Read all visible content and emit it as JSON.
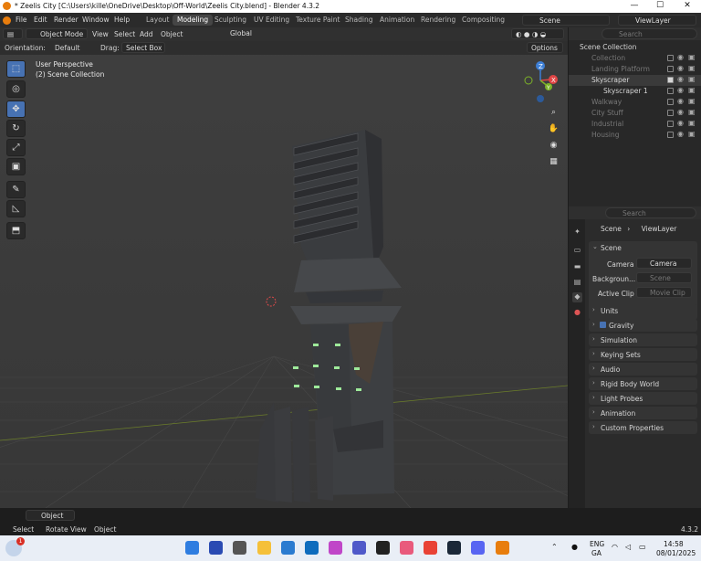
{
  "window": {
    "title": "* Zeelis City [C:\\Users\\kille\\OneDrive\\Desktop\\Off-World\\Zeelis City.blend] - Blender 4.3.2",
    "min": "—",
    "max": "☐",
    "close": "✕"
  },
  "menus": [
    "File",
    "Edit",
    "Render",
    "Window",
    "Help"
  ],
  "workspaces": [
    "Layout",
    "Modeling",
    "Sculpting",
    "UV Editing",
    "Texture Paint",
    "Shading",
    "Animation",
    "Rendering",
    "Compositing"
  ],
  "active_workspace": "Modeling",
  "scene": "Scene",
  "view_layer": "ViewLayer",
  "header": {
    "mode": "Object Mode",
    "view": "View",
    "select": "Select",
    "add": "Add",
    "object": "Object",
    "transform": "Global"
  },
  "toolsettings": {
    "orientation_label": "Orientation:",
    "orientation": "Default",
    "drag_label": "Drag:",
    "drag": "Select Box",
    "options": "Options"
  },
  "viewport": {
    "line1": "User Perspective",
    "line2": "(2) Scene Collection"
  },
  "gizmo": {
    "x": "X",
    "y": "Y",
    "z": "Z"
  },
  "search_placeholder": "Search",
  "outliner": [
    {
      "name": "Scene Collection",
      "level": 0,
      "dim": false,
      "checked": false,
      "icons": false
    },
    {
      "name": "Collection",
      "level": 1,
      "dim": true,
      "checked": false,
      "icons": true
    },
    {
      "name": "Landing Platform",
      "level": 1,
      "dim": true,
      "checked": false,
      "icons": true
    },
    {
      "name": "Skyscraper",
      "level": 1,
      "dim": false,
      "checked": true,
      "icons": true
    },
    {
      "name": "Skyscraper 1",
      "level": 2,
      "dim": false,
      "checked": false,
      "icons": true
    },
    {
      "name": "Walkway",
      "level": 1,
      "dim": true,
      "checked": false,
      "icons": true
    },
    {
      "name": "City Stuff",
      "level": 1,
      "dim": true,
      "checked": false,
      "icons": true
    },
    {
      "name": "Industrial",
      "level": 1,
      "dim": true,
      "checked": false,
      "icons": true
    },
    {
      "name": "Housing",
      "level": 1,
      "dim": true,
      "checked": false,
      "icons": true
    }
  ],
  "props": {
    "breadcrumb_scene": "Scene",
    "breadcrumb_layer": "ViewLayer",
    "scene_panel": "Scene",
    "camera_label": "Camera",
    "camera_value": "Camera",
    "background_label": "Backgroun...",
    "background_placeholder": "Scene",
    "clip_label": "Active Clip",
    "clip_placeholder": "Movie Clip",
    "panels": [
      "Units",
      "Gravity",
      "Simulation",
      "Keying Sets",
      "Audio",
      "Rigid Body World",
      "Light Probes",
      "Animation",
      "Custom Properties"
    ]
  },
  "bottom": {
    "mode": "Object",
    "status_select": "Select",
    "status_rotate": "Rotate View",
    "status_object": "Object",
    "version": "4.3.2"
  },
  "taskbar": {
    "lang1": "ENG",
    "lang2": "GA",
    "time": "14:58",
    "date": "08/01/2025",
    "badge": "1"
  }
}
